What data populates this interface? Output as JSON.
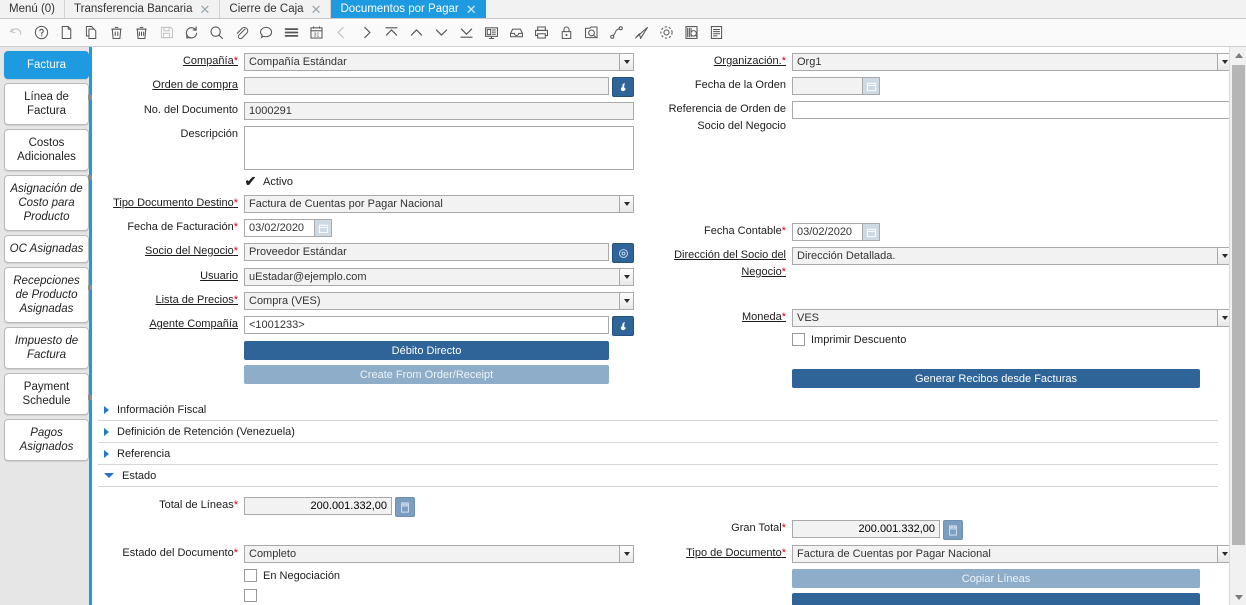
{
  "window_tabs": [
    {
      "label": "Menú (0)",
      "closable": false,
      "active": false
    },
    {
      "label": "Transferencia Bancaria",
      "closable": true,
      "active": false
    },
    {
      "label": "Cierre de Caja",
      "closable": true,
      "active": false
    },
    {
      "label": "Documentos por Pagar",
      "closable": true,
      "active": true
    }
  ],
  "toolbar": {
    "icons": [
      "undo-icon",
      "help-icon",
      "new-icon",
      "copy-icon",
      "delete-icon",
      "delete-all-icon",
      "save-icon",
      "refresh-icon",
      "find-icon",
      "attachment-icon",
      "chat-icon",
      "menu-lines-icon",
      "calendar-icon",
      "previous-icon",
      "next-icon",
      "first-record-icon",
      "up-record-icon",
      "down-record-icon",
      "last-record-icon",
      "report-icon",
      "archive-icon",
      "print-icon",
      "lock-icon",
      "zoom-across-icon",
      "workflow-icon",
      "send-icon",
      "settings-icon",
      "product-info-icon",
      "list-view-icon"
    ]
  },
  "sidebar": {
    "items": [
      {
        "label": "Factura",
        "active": true,
        "italic": false
      },
      {
        "label": "Línea de Factura",
        "active": false,
        "italic": false
      },
      {
        "label": "Costos Adicionales",
        "active": false,
        "italic": false
      },
      {
        "label": "Asignación de Costo para Producto",
        "active": false,
        "italic": true
      },
      {
        "label": "OC Asignadas",
        "active": false,
        "italic": true
      },
      {
        "label": "Recepciones de Producto Asignadas",
        "active": false,
        "italic": true
      },
      {
        "label": "Impuesto de Factura",
        "active": false,
        "italic": true
      },
      {
        "label": "Payment Schedule",
        "active": false,
        "italic": false
      },
      {
        "label": "Pagos Asignados",
        "active": false,
        "italic": true
      }
    ]
  },
  "form": {
    "compania": {
      "label": "Compañía",
      "required": true,
      "value": "Compañía Estándar"
    },
    "orden_compra": {
      "label": "Orden de compra",
      "required": false,
      "value": ""
    },
    "no_documento": {
      "label": "No. del Documento",
      "required": false,
      "value": "1000291"
    },
    "descripcion": {
      "label": "Descripción",
      "required": false,
      "value": ""
    },
    "activo": {
      "label": "Activo",
      "checked": true
    },
    "tipo_doc_destino": {
      "label": "Tipo Documento Destino",
      "required": true,
      "value": "Factura de Cuentas por Pagar Nacional"
    },
    "fecha_facturacion": {
      "label": "Fecha de Facturación",
      "required": true,
      "value": "03/02/2020"
    },
    "socio_negocio": {
      "label": "Socio del Negocio",
      "required": true,
      "value": "Proveedor Estándar"
    },
    "usuario": {
      "label": "Usuario",
      "required": false,
      "value": "uEstadar@ejemplo.com"
    },
    "lista_precios": {
      "label": "Lista de Precios",
      "required": true,
      "value": "Compra (VES)"
    },
    "agente_compania": {
      "label": "Agente Compañía",
      "required": false,
      "value": "<1001233>"
    },
    "organizacion": {
      "label": "Organización.",
      "required": true,
      "value": "Org1"
    },
    "fecha_orden": {
      "label": "Fecha de la Orden",
      "required": false,
      "value": ""
    },
    "referencia_orden": {
      "label": "Referencia de Orden de Socio del Negocio",
      "required": false,
      "value": ""
    },
    "fecha_contable": {
      "label": "Fecha Contable",
      "required": true,
      "value": "03/02/2020"
    },
    "direccion_socio": {
      "label": "Dirección del Socio del Negocio",
      "required": true,
      "value": "Dirección Detallada."
    },
    "moneda": {
      "label": "Moneda",
      "required": true,
      "value": "VES"
    },
    "imprimir_descuento": {
      "label": "Imprimir Descuento",
      "checked": false
    },
    "btn_debito_directo": "Débito Directo",
    "btn_create_from_order": "Create From Order/Receipt",
    "btn_generar_recibos": "Generar Recibos desde Facturas"
  },
  "sections": [
    {
      "label": "Información Fiscal",
      "expanded": false
    },
    {
      "label": "Definición de Retención (Venezuela)",
      "expanded": false
    },
    {
      "label": "Referencia",
      "expanded": false
    },
    {
      "label": "Estado",
      "expanded": true
    }
  ],
  "estado": {
    "total_lineas": {
      "label": "Total de Líneas",
      "required": true,
      "value": "200.001.332,00"
    },
    "gran_total": {
      "label": "Gran Total",
      "required": true,
      "value": "200.001.332,00"
    },
    "estado_documento": {
      "label": "Estado del Documento",
      "required": true,
      "value": "Completo"
    },
    "tipo_documento": {
      "label": "Tipo de Documento",
      "required": true,
      "value": "Factura de Cuentas por Pagar Nacional"
    },
    "en_negociacion": {
      "label": "En Negociación",
      "checked": false
    },
    "btn_copiar_lineas": "Copiar Líneas"
  },
  "colors": {
    "accent_blue": "#1e9ae0",
    "button_blue": "#2f6499",
    "button_light_blue": "#8dadc9",
    "required_red": "#d0021b",
    "rail_bg": "#e6e6e6"
  }
}
